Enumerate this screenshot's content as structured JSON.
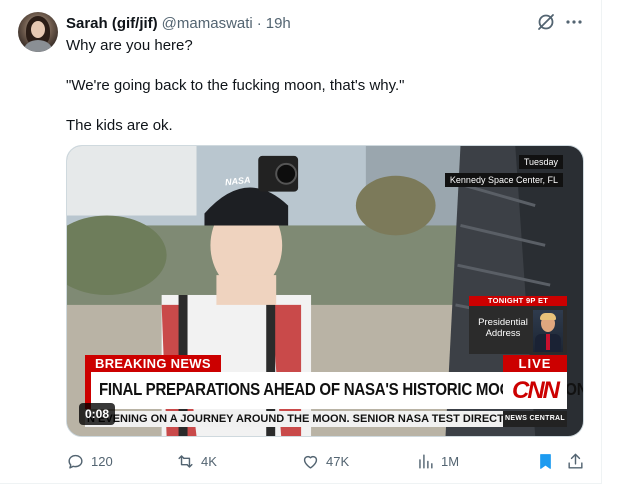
{
  "tweet": {
    "author_name": "Sarah (gif/jif)",
    "handle": "@mamaswati",
    "separator": "·",
    "time": "19h",
    "lines": [
      "Why are you here?",
      "\"We're going back to the fucking moon, that's why.\"",
      "The kids are ok."
    ]
  },
  "icons": {
    "grok": "grok-icon",
    "more": "more-options-icon",
    "reply": "reply-icon",
    "retweet": "retweet-icon",
    "like": "heart-icon",
    "views": "views-icon",
    "bookmark": "bookmark-icon",
    "share": "share-icon"
  },
  "media": {
    "location_day": "Tuesday",
    "location_place": "Kennedy Space Center, FL",
    "tonight_tag": "TONIGHT 9P ET",
    "tonight_title": "Presidential Address",
    "breaking_label": "BREAKING NEWS",
    "live_label": "LIVE",
    "headline": "FINAL PREPARATIONS AHEAD OF NASA'S HISTORIC MOON MISSION",
    "network_logo": "CNN",
    "ticker": "EVENING ON A JOURNEY AROUND THE MOON. SENIOR NASA TEST DIRECTOR JEFF",
    "ticker_prefix": "N",
    "news_central": "NEWS CENTRAL",
    "cap_text": "NASA",
    "duration": "0:08"
  },
  "metrics": {
    "replies": "120",
    "retweets": "4K",
    "likes": "47K",
    "views": "1M"
  },
  "colors": {
    "breaking_red": "#cc0000",
    "bookmark_blue": "#1d9bf0",
    "secondary_text": "#536471"
  }
}
